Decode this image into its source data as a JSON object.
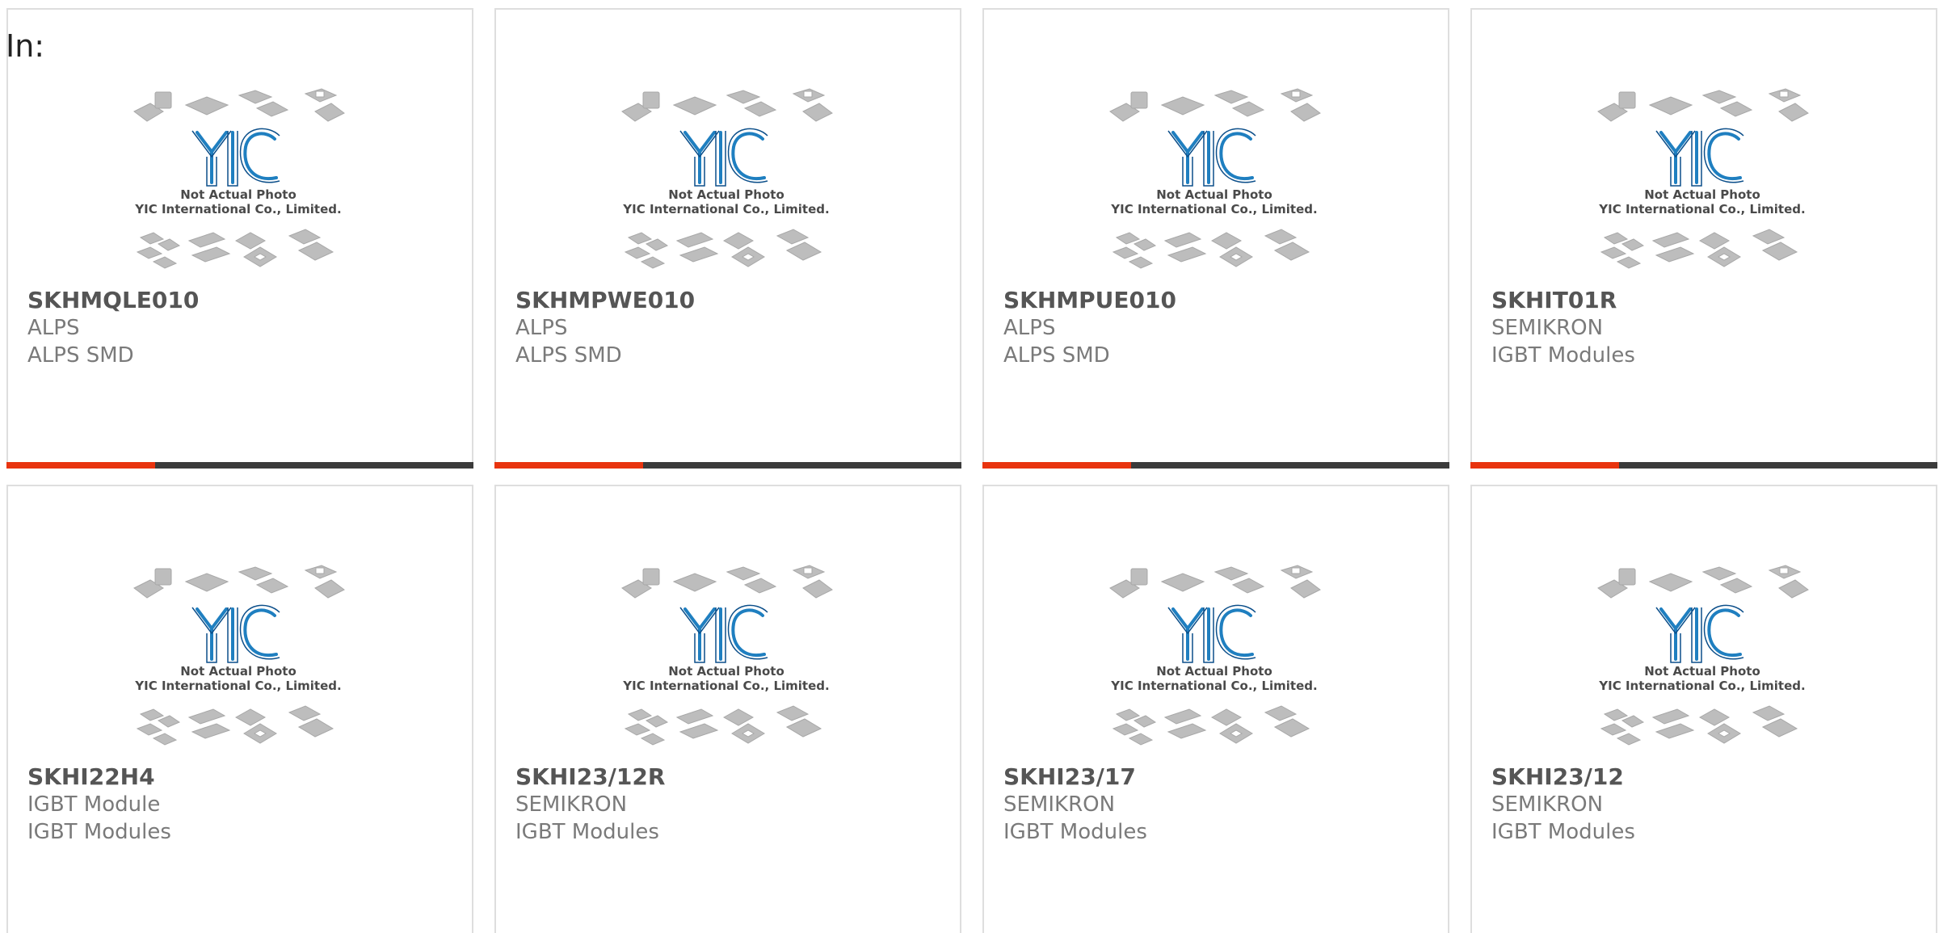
{
  "header": {
    "label": "In:"
  },
  "placeholder": {
    "caption_line1": "Not Actual Photo",
    "caption_line2": "YIC International Co., Limited.",
    "logo_text": "YIC"
  },
  "colors": {
    "accent": "#e8340f",
    "bar": "#3b3b3b",
    "logo": "#1f7fc0"
  },
  "products": [
    {
      "part": "SKHMQLE010",
      "manufacturer": "ALPS",
      "category": "ALPS SMD"
    },
    {
      "part": "SKHMPWE010",
      "manufacturer": "ALPS",
      "category": "ALPS SMD"
    },
    {
      "part": "SKHMPUE010",
      "manufacturer": "ALPS",
      "category": "ALPS SMD"
    },
    {
      "part": "SKHIT01R",
      "manufacturer": "SEMIKRON",
      "category": "IGBT Modules"
    },
    {
      "part": "SKHI22H4",
      "manufacturer": "IGBT Module",
      "category": "IGBT Modules"
    },
    {
      "part": "SKHI23/12R",
      "manufacturer": "SEMIKRON",
      "category": "IGBT Modules"
    },
    {
      "part": "SKHI23/17",
      "manufacturer": "SEMIKRON",
      "category": "IGBT Modules"
    },
    {
      "part": "SKHI23/12",
      "manufacturer": "SEMIKRON",
      "category": "IGBT Modules"
    }
  ]
}
